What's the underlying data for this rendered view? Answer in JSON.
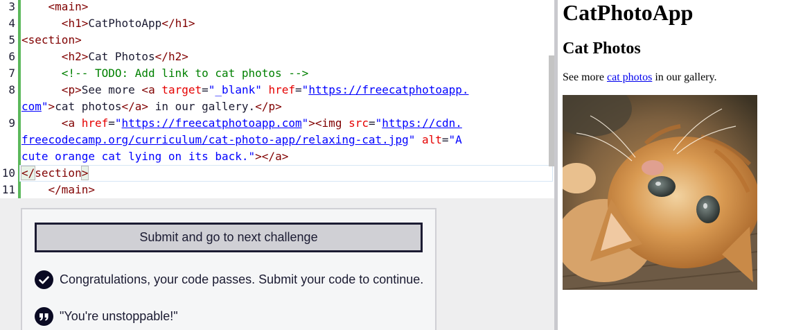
{
  "editor": {
    "line_numbers": [
      "3",
      "4",
      "5",
      "6",
      "7",
      "8",
      "",
      "9",
      "",
      "",
      "10",
      "11"
    ],
    "lines": {
      "l3": {
        "indent": "    ",
        "open": "<",
        "tag": "main",
        "close": ">"
      },
      "l4": {
        "indent": "      ",
        "open1": "<",
        "tag1": "h1",
        "close1": ">",
        "text": "CatPhotoApp",
        "open2": "</",
        "tag2": "h1",
        "close2": ">"
      },
      "l5": {
        "open": "<",
        "tag": "section",
        "close": ">"
      },
      "l6": {
        "indent": "      ",
        "open1": "<",
        "tag1": "h2",
        "close1": ">",
        "text": "Cat Photos",
        "open2": "</",
        "tag2": "h2",
        "close2": ">"
      },
      "l7": {
        "indent": "      ",
        "comment": "<!-- TODO: Add link to cat photos -->"
      },
      "l8a": {
        "indent": "      ",
        "p_open": "<",
        "p_tag": "p",
        "p_close": ">",
        "text1": "See more ",
        "a_open": "<",
        "a_tag": "a",
        "sp1": " ",
        "attr1": "target",
        "eq1": "=",
        "q1": "\"",
        "val1": "_blank",
        "q2": "\"",
        "sp2": " ",
        "attr2": "href",
        "eq2": "=",
        "q3": "\"",
        "url_part1": "https://freecatphotoapp."
      },
      "l8b": {
        "url_part2": "com",
        "q4": "\"",
        "gt": ">",
        "text2": "cat photos",
        "a_end_open": "</",
        "a_end_tag": "a",
        "a_end_close": ">",
        "text3": " in our gallery.",
        "p_end_open": "</",
        "p_end_tag": "p",
        "p_end_close": ">"
      },
      "l9a": {
        "indent": "      ",
        "a_open": "<",
        "a_tag": "a",
        "sp1": " ",
        "attr1": "href",
        "eq1": "=",
        "q1": "\"",
        "url": "https://freecatphotoapp.com",
        "q2": "\"",
        "gt": ">",
        "img_open": "<",
        "img_tag": "img",
        "sp2": " ",
        "attr2": "src",
        "eq2": "=",
        "q3": "\"",
        "src_part1": "https://cdn."
      },
      "l9b": {
        "src_part2": "freecodecamp.org/curriculum/cat-photo-app/relaxing-cat.jpg",
        "q4": "\"",
        "sp": " ",
        "attr3": "alt",
        "eq3": "=",
        "q5": "\"",
        "alt_part1": "A"
      },
      "l9c": {
        "alt_part2": "cute orange cat lying on its back.",
        "q6": "\"",
        "gt2": ">",
        "a_end_open": "</",
        "a_end_tag": "a",
        "a_end_close": ">"
      },
      "l10": {
        "open": "</",
        "tag": "section",
        "close": ">"
      },
      "l11": {
        "indent": "    ",
        "open": "</",
        "tag": "main",
        "close": ">"
      }
    }
  },
  "results": {
    "submit_label": "Submit and go to next challenge",
    "success_message": "Congratulations, your code passes. Submit your code to continue.",
    "quote": "\"You're unstoppable!\"",
    "success_icon": "check-circle-icon",
    "quote_icon": "quote-icon"
  },
  "preview": {
    "h1": "CatPhotoApp",
    "h2": "Cat Photos",
    "p_before": "See more ",
    "p_link": "cat photos",
    "p_after": " in our gallery.",
    "image_alt": "A cute orange cat lying on its back."
  },
  "colors": {
    "tag": "#800000",
    "attribute": "#e50000",
    "string": "#0000ff",
    "comment": "#008000",
    "gutter_pass": "#5cb85c",
    "button_bg": "#d0d0d5",
    "button_border": "#1b1b32"
  }
}
